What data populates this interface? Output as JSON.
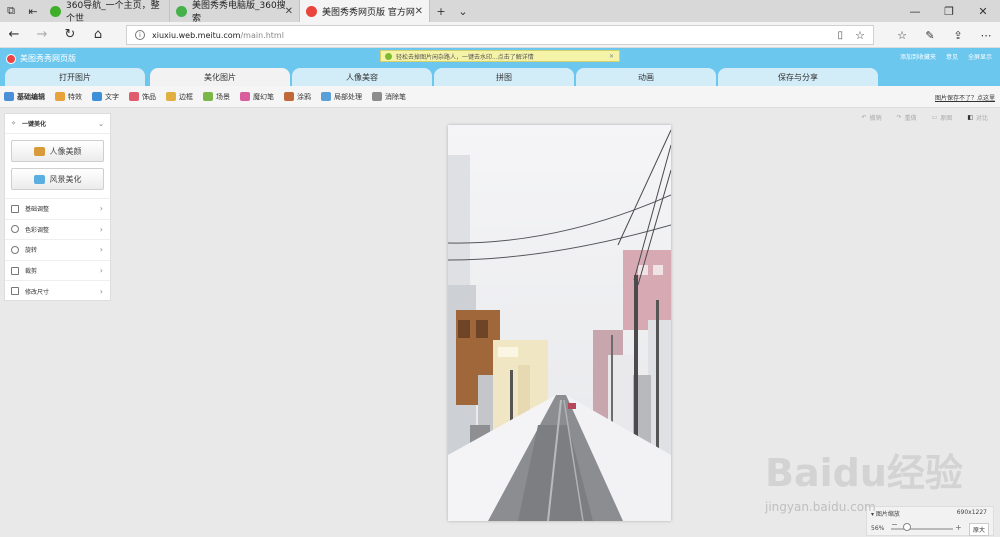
{
  "browser": {
    "tabs": [
      {
        "label": "360导航_一个主页，整个世",
        "active": false,
        "favicon_color": "#3fae29"
      },
      {
        "label": "美图秀秀电脑版_360搜索",
        "active": false,
        "favicon_color": "#46b04a"
      },
      {
        "label": "美图秀秀网页版 官方网",
        "active": true,
        "favicon_color": "#e9453c"
      }
    ],
    "url_host": "xiuxiu.web.meitu.com",
    "url_path": "/main.html"
  },
  "app": {
    "logo_text": "美图秀秀网页版",
    "notice": "轻松去掉图片闲杂路人，一键去水印...点击了解详情",
    "header_links": [
      "添加到收藏夹",
      "意见",
      "全屏显示"
    ],
    "tabs": [
      {
        "label": "打开图片",
        "active": false
      },
      {
        "label": "美化图片",
        "active": true
      },
      {
        "label": "人像美容",
        "active": false
      },
      {
        "label": "拼图",
        "active": false
      },
      {
        "label": "动画",
        "active": false
      },
      {
        "label": "保存与分享",
        "active": false
      }
    ],
    "tools": [
      {
        "label": "基础编辑",
        "color": "#4a90d9"
      },
      {
        "label": "特效",
        "color": "#e8a23c"
      },
      {
        "label": "文字",
        "color": "#3d8fd8"
      },
      {
        "label": "饰品",
        "color": "#e05b6d"
      },
      {
        "label": "边框",
        "color": "#e0b040"
      },
      {
        "label": "场景",
        "color": "#7ab648"
      },
      {
        "label": "魔幻笔",
        "color": "#d95c9c"
      },
      {
        "label": "涂鸦",
        "color": "#c0683a"
      },
      {
        "label": "局部处理",
        "color": "#5aa0d8"
      },
      {
        "label": "消除笔",
        "color": "#8c8c8c"
      }
    ],
    "tool_hint": "图片保存不了？点这里"
  },
  "panel": {
    "title": "一键美化",
    "buttons": [
      {
        "label": "人像美颜",
        "color": "#d99a3c"
      },
      {
        "label": "风景美化",
        "color": "#5aaee0"
      }
    ],
    "items": [
      "基础调整",
      "色彩调整",
      "旋转",
      "裁剪",
      "修改尺寸"
    ]
  },
  "canvas_controls": [
    "撤销",
    "重做",
    "原图",
    "对比"
  ],
  "zoom": {
    "label": "图片缩放",
    "size": "690x1227",
    "percent": "56%",
    "level": 0.56,
    "original_button": "原大"
  },
  "watermark": {
    "brand": "Baidu经验",
    "url": "jingyan.baidu.com"
  }
}
